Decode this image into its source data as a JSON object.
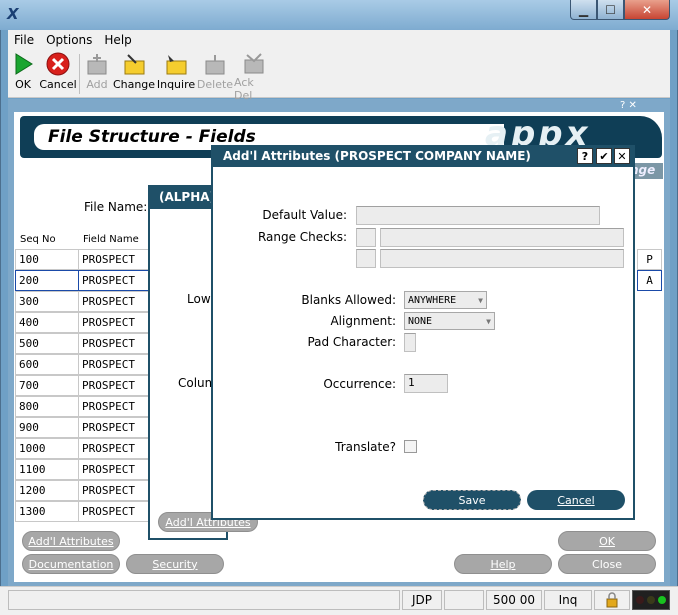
{
  "window": {
    "minimize": "▁",
    "maximize": "☐",
    "close": "✕"
  },
  "menu": [
    "File",
    "Options",
    "Help"
  ],
  "toolbar": {
    "ok": "OK",
    "cancel": "Cancel",
    "add": "Add",
    "change": "Change",
    "inquire": "Inquire",
    "delete": "Delete",
    "ack_del": "Ack Del"
  },
  "panel": {
    "title": "File Structure - Fields",
    "logo": "appx",
    "tab_partial": "nge",
    "file_name_label": "File Name:",
    "col_seq": "Seq No",
    "col_field": "Field Name",
    "rows": [
      {
        "seq": "100",
        "name": "PROSPECT",
        "flag": "P"
      },
      {
        "seq": "200",
        "name": "PROSPECT",
        "flag": "A"
      },
      {
        "seq": "300",
        "name": "PROSPECT",
        "flag": ""
      },
      {
        "seq": "400",
        "name": "PROSPECT",
        "flag": ""
      },
      {
        "seq": "500",
        "name": "PROSPECT",
        "flag": ""
      },
      {
        "seq": "600",
        "name": "PROSPECT",
        "flag": ""
      },
      {
        "seq": "700",
        "name": "PROSPECT",
        "flag": ""
      },
      {
        "seq": "800",
        "name": "PROSPECT",
        "flag": ""
      },
      {
        "seq": "900",
        "name": "PROSPECT",
        "flag": ""
      },
      {
        "seq": "1000",
        "name": "PROSPECT",
        "flag": ""
      },
      {
        "seq": "1100",
        "name": "PROSPECT",
        "flag": ""
      },
      {
        "seq": "1200",
        "name": "PROSPECT",
        "flag": ""
      },
      {
        "seq": "1300",
        "name": "PROSPECT",
        "flag": ""
      }
    ],
    "buttons": {
      "addl_attributes": "Add'l Attributes",
      "documentation": "Documentation",
      "security": "Security",
      "help": "Help",
      "close": "Close",
      "ok": "OK"
    }
  },
  "alpha_dialog": {
    "title": "(ALPHA)",
    "low_label": "Low",
    "colu_label": "Colum",
    "addl_button": "Add'l Attributes"
  },
  "attr_dialog": {
    "title": "Add'l Attributes  (PROSPECT COMPANY NAME)",
    "help_btn": "?",
    "ok_btn": "✔",
    "close_btn": "✕",
    "default_value_label": "Default Value:",
    "default_value": "",
    "range_checks_label": "Range Checks:",
    "blanks_allowed_label": "Blanks Allowed:",
    "blanks_allowed_value": "ANYWHERE",
    "alignment_label": "Alignment:",
    "alignment_value": "NONE",
    "pad_character_label": "Pad Character:",
    "occurrence_label": "Occurrence:",
    "occurrence_value": "1",
    "translate_label": "Translate?",
    "save_label": "Save",
    "cancel_label": "Cancel"
  },
  "status": {
    "user": "JDP",
    "time": "500 00",
    "mode": "Inq"
  }
}
